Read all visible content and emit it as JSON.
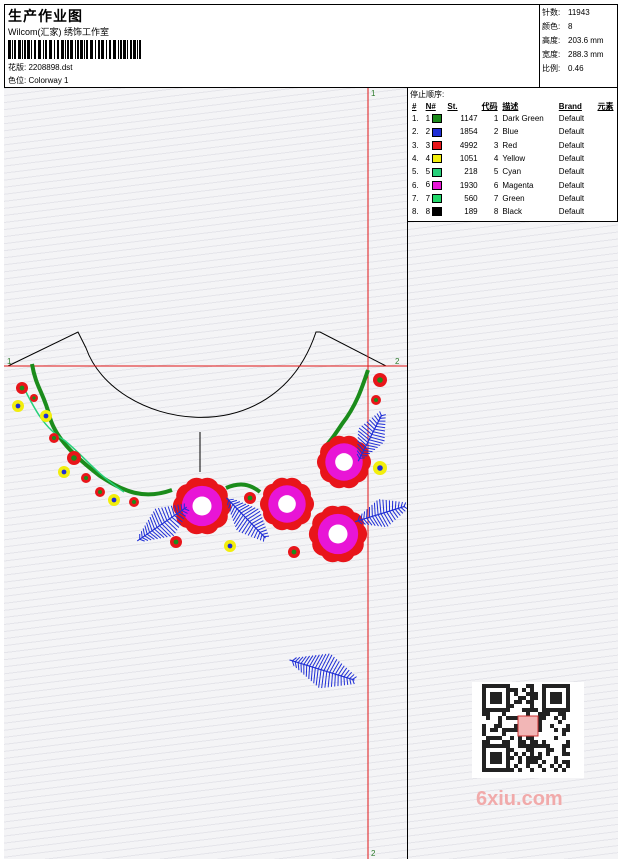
{
  "header": {
    "title": "生产作业图",
    "studio": "Wilcom(汇家) 绣饰工作室",
    "design_label": "花版:",
    "design_file": "2208898.dst",
    "colorway_label": "色位:",
    "colorway": "Colorway 1"
  },
  "stats": {
    "stitches_label": "针数:",
    "stitches": "11943",
    "colors_label": "颜色:",
    "colors": "8",
    "height_label": "高度:",
    "height": "203.6 mm",
    "width_label": "宽度:",
    "width": "288.3 mm",
    "scale_label": "比例:",
    "scale": "0.46"
  },
  "thread_panel": {
    "title": "停止顺序:",
    "headers": [
      "#",
      "N#",
      "St.",
      "代码",
      "描述",
      "Brand",
      "元素"
    ],
    "rows": [
      {
        "idx": "1.",
        "n": "1",
        "color": "#1a8a1a",
        "st": "1147",
        "code": "1",
        "desc": "Dark Green",
        "brand": "Default"
      },
      {
        "idx": "2.",
        "n": "2",
        "color": "#1f2ed6",
        "st": "1854",
        "code": "2",
        "desc": "Blue",
        "brand": "Default"
      },
      {
        "idx": "3.",
        "n": "3",
        "color": "#e8151a",
        "st": "4992",
        "code": "3",
        "desc": "Red",
        "brand": "Default"
      },
      {
        "idx": "4.",
        "n": "4",
        "color": "#f2ee0c",
        "st": "1051",
        "code": "4",
        "desc": "Yellow",
        "brand": "Default"
      },
      {
        "idx": "5.",
        "n": "5",
        "color": "#27d07a",
        "st": "218",
        "code": "5",
        "desc": "Cyan",
        "brand": "Default"
      },
      {
        "idx": "6.",
        "n": "6",
        "color": "#e815d6",
        "st": "1930",
        "code": "6",
        "desc": "Magenta",
        "brand": "Default"
      },
      {
        "idx": "7.",
        "n": "7",
        "color": "#22d86a",
        "st": "560",
        "code": "7",
        "desc": "Green",
        "brand": "Default"
      },
      {
        "idx": "8.",
        "n": "8",
        "color": "#000000",
        "st": "189",
        "code": "8",
        "desc": "Black",
        "brand": "Default"
      }
    ]
  },
  "markers": {
    "v_top": "1",
    "v_bottom": "2",
    "h_left": "1",
    "h_right": "2"
  },
  "watermark": "6xiu.com",
  "colors": {
    "guide": "#e01515",
    "stem": "#1b8c1b",
    "leaf": "#1f2ed6",
    "petal": "#e8151a",
    "center": "#e815d6",
    "bud": "#f2ee0c"
  }
}
